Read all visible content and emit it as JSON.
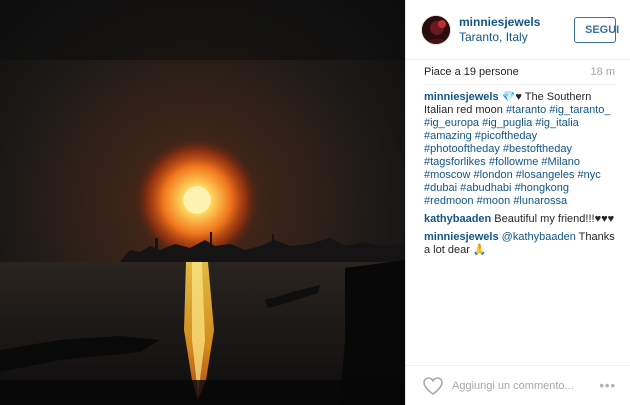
{
  "header": {
    "username": "minniesjewels",
    "location": "Taranto, Italy",
    "follow_label": "SEGUI"
  },
  "meta": {
    "likes": "Piace a 19 persone",
    "time": "18 m"
  },
  "caption": {
    "user": "minniesjewels",
    "hearts": "💎♥",
    "text": " The Southern Italian red moon ",
    "hashtags": [
      "#taranto",
      "#ig_taranto_",
      "#ig_europa",
      "#ig_puglia",
      "#ig_italia",
      "#amazing",
      "#picoftheday",
      "#photooftheday",
      "#bestoftheday",
      "#tagsforlikes",
      "#followme",
      "#Milano",
      "#moscow",
      "#london",
      "#losangeles",
      "#nyc",
      "#dubai",
      "#abudhabi",
      "#hongkong",
      "#redmoon",
      "#moon",
      "#lunarossa"
    ]
  },
  "comments": [
    {
      "user": "kathybaaden",
      "text": " Beautiful my friend!!!♥♥♥"
    },
    {
      "user": "minniesjewels",
      "mention": "@kathybaaden",
      "text": " Thanks a lot dear 🙏"
    }
  ],
  "footer": {
    "comment_placeholder": "Aggiungi un commento...",
    "more_label": "•••",
    "heart_icon": "heart-outline-icon"
  },
  "colors": {
    "link": "#125688",
    "follow": "#3f729b",
    "muted": "#a5a7aa"
  }
}
